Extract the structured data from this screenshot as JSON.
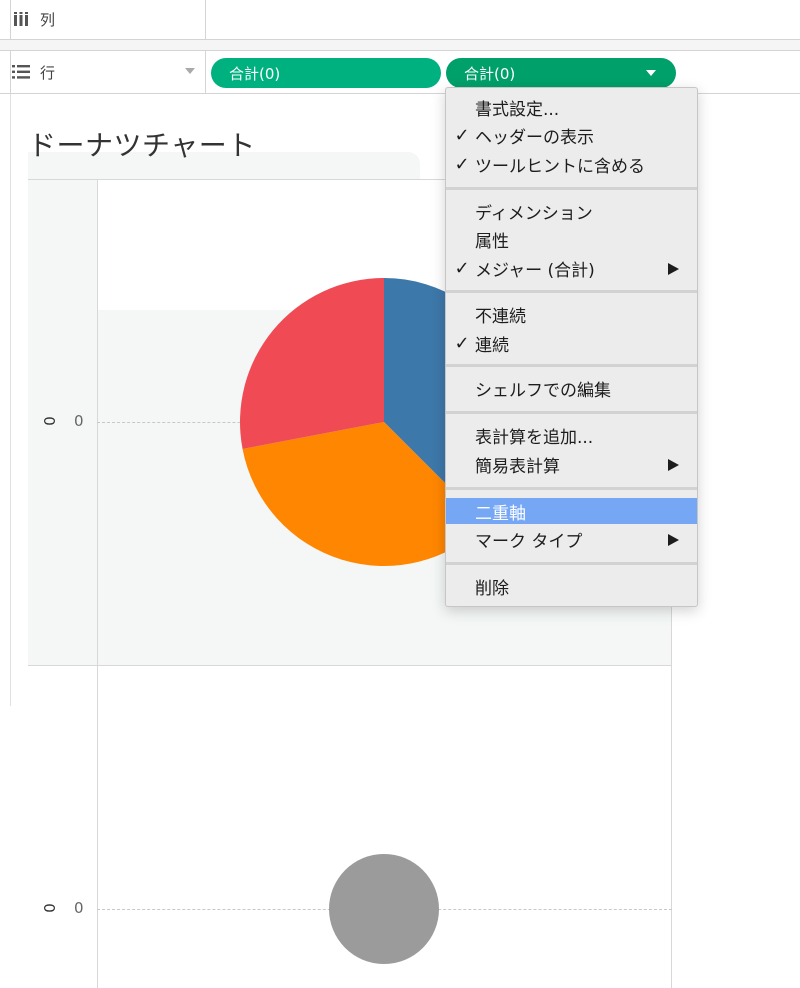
{
  "columns_shelf": {
    "label": "列",
    "icon": "columns-icon"
  },
  "rows_shelf": {
    "label": "行",
    "icon": "rows-list-icon",
    "pills": [
      {
        "label": "合計(0)",
        "color": "#00b180"
      },
      {
        "label": "合計(0)",
        "color": "#00a06b"
      }
    ]
  },
  "sheet": {
    "title": "ドーナツチャート"
  },
  "panes": [
    {
      "axis_tick": "0",
      "axis_value_label": "0"
    },
    {
      "axis_tick": "0",
      "axis_value_label": "0"
    }
  ],
  "chart_data": [
    {
      "type": "pie",
      "slices": [
        {
          "color": "#3d78aa",
          "share": 0.375
        },
        {
          "color": "#ff8600",
          "share": 0.345
        },
        {
          "color": "#f04b55",
          "share": 0.28
        }
      ]
    },
    {
      "type": "pie",
      "slices": [
        {
          "color": "#9b9b9b",
          "share": 1.0
        }
      ]
    }
  ],
  "context_menu": {
    "items": [
      {
        "label": "書式設定...",
        "checked": false
      },
      {
        "label": "ヘッダーの表示",
        "checked": true
      },
      {
        "label": "ツールヒントに含める",
        "checked": true
      },
      {
        "label": "ディメンション",
        "checked": false
      },
      {
        "label": "属性",
        "checked": false
      },
      {
        "label": "メジャー (合計)",
        "checked": true,
        "submenu": true
      },
      {
        "label": "不連続",
        "checked": false
      },
      {
        "label": "連続",
        "checked": true
      },
      {
        "label": "シェルフでの編集",
        "checked": false
      },
      {
        "label": "表計算を追加...",
        "checked": false
      },
      {
        "label": "簡易表計算",
        "checked": false,
        "submenu": true
      },
      {
        "label": "二重軸",
        "checked": false,
        "highlighted": true
      },
      {
        "label": "マーク タイプ",
        "checked": false,
        "submenu": true
      },
      {
        "label": "削除",
        "checked": false
      }
    ],
    "check_glyph": "✓"
  }
}
